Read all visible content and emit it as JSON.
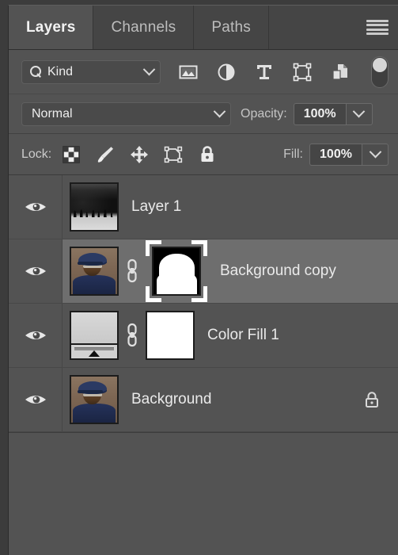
{
  "panel": {
    "tabs": [
      {
        "label": "Layers",
        "active": true
      },
      {
        "label": "Channels",
        "active": false
      },
      {
        "label": "Paths",
        "active": false
      }
    ],
    "menu_icon": "hamburger-menu-icon"
  },
  "filter": {
    "kind_label": "Kind",
    "search_icon": "search-icon",
    "dropdown_icon": "chevron-down-icon",
    "type_filters": [
      {
        "name": "filter-pixel-layers",
        "icon": "image-icon"
      },
      {
        "name": "filter-adjustment-layers",
        "icon": "adjustment-half-circle-icon"
      },
      {
        "name": "filter-type-layers",
        "icon": "text-t-icon"
      },
      {
        "name": "filter-shape-layers",
        "icon": "shape-bounding-box-icon"
      },
      {
        "name": "filter-smart-objects",
        "icon": "smart-object-document-icon"
      }
    ],
    "toggle_icon": "filter-enable-toggle"
  },
  "blend": {
    "mode": "Normal",
    "mode_dropdown_icon": "chevron-down-icon",
    "opacity_label": "Opacity:",
    "opacity_value": "100%",
    "opacity_stepper_icon": "chevron-down-icon"
  },
  "lock": {
    "label": "Lock:",
    "items": [
      {
        "name": "lock-transparent-pixels",
        "icon": "checkerboard-icon"
      },
      {
        "name": "lock-image-pixels",
        "icon": "paintbrush-icon"
      },
      {
        "name": "lock-position",
        "icon": "move-arrows-icon"
      },
      {
        "name": "lock-artboard-nesting",
        "icon": "artboard-icon"
      },
      {
        "name": "lock-all",
        "icon": "padlock-icon"
      }
    ],
    "fill_label": "Fill:",
    "fill_value": "100%",
    "fill_stepper_icon": "chevron-down-icon"
  },
  "layers": [
    {
      "name": "Layer 1",
      "visible": true,
      "visibility_icon": "eye-icon",
      "selected": false,
      "thumb": "dark-forest-snow-thumbnail",
      "has_mask": false,
      "linked": false,
      "locked": false
    },
    {
      "name": "Background copy",
      "visible": true,
      "visibility_icon": "eye-icon",
      "selected": true,
      "thumb": "portrait-man-blue-cap-thumbnail",
      "has_mask": true,
      "mask_type": "silhouette-mask",
      "mask_selected": true,
      "linked": true,
      "link_icon": "chain-link-icon",
      "locked": false
    },
    {
      "name": "Color Fill 1",
      "visible": true,
      "visibility_icon": "eye-icon",
      "selected": false,
      "thumb": "solid-color-fill-swatch-thumbnail",
      "has_mask": true,
      "mask_type": "white-mask",
      "mask_selected": false,
      "linked": true,
      "link_icon": "chain-link-icon",
      "locked": false
    },
    {
      "name": "Background",
      "visible": true,
      "visibility_icon": "eye-icon",
      "selected": false,
      "thumb": "portrait-man-blue-cap-thumbnail",
      "has_mask": false,
      "linked": false,
      "locked": true,
      "lock_icon": "padlock-icon"
    }
  ],
  "colors": {
    "panel_bg": "#535353",
    "tab_inactive_bg": "#454545",
    "selected_row_bg": "#6e6e6e",
    "text_primary": "#eaeaea",
    "text_secondary": "#c4c4c4",
    "field_bg": "#454545",
    "empty_area_bg": "#4f4f4f"
  }
}
